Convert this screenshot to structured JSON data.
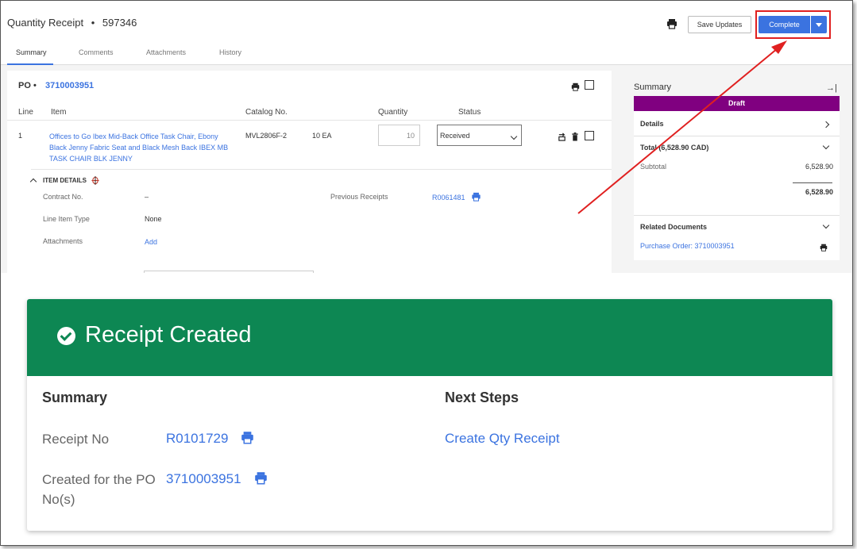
{
  "header": {
    "title": "Quantity Receipt",
    "separator": "•",
    "receipt_id": "597346",
    "save_label": "Save Updates",
    "complete_label": "Complete"
  },
  "tabs": [
    {
      "label": "Summary"
    },
    {
      "label": "Comments"
    },
    {
      "label": "Attachments"
    },
    {
      "label": "History"
    }
  ],
  "po": {
    "label": "PO",
    "separator": "•",
    "number": "3710003951",
    "columns": {
      "line": "Line",
      "item": "Item",
      "catalog": "Catalog No.",
      "quantity": "Quantity",
      "status": "Status"
    },
    "line_item": {
      "line": "1",
      "item": "Offices to Go Ibex Mid-Back Office Task Chair, Ebony Black Jenny Fabric Seat and Black Mesh Back IBEX MB TASK CHAIR BLK JENNY",
      "catalog": "MVL2806F-2",
      "uom_qty": "10 EA",
      "quantity_value": "10",
      "status": "Received"
    },
    "item_details": {
      "heading": "ITEM DETAILS",
      "contract_label": "Contract No.",
      "contract_value": "–",
      "line_type_label": "Line Item Type",
      "line_type_value": "None",
      "attachments_label": "Attachments",
      "attachments_action": "Add",
      "previous_receipts_label": "Previous Receipts",
      "previous_receipts_value": "R0061481"
    }
  },
  "summary_panel": {
    "title": "Summary",
    "status": "Draft",
    "details_label": "Details",
    "total_label": "Total (6,528.90 CAD)",
    "subtotal_label": "Subtotal",
    "subtotal_value": "6,528.90",
    "total_value": "6,528.90",
    "related_label": "Related Documents",
    "related_link": "Purchase Order: 3710003951"
  },
  "receipt_created": {
    "title": "Receipt Created",
    "summary_heading": "Summary",
    "next_steps_heading": "Next Steps",
    "receipt_no_label": "Receipt No",
    "receipt_no_value": "R0101729",
    "created_for_label_1": "Created for the PO",
    "created_for_label_2": "No(s)",
    "created_for_value": "3710003951",
    "next_step_link": "Create Qty Receipt"
  },
  "colors": {
    "accent_blue": "#3b73e0",
    "success_green": "#0d8753",
    "draft_purple": "#800080",
    "highlight_red": "#e02020"
  }
}
